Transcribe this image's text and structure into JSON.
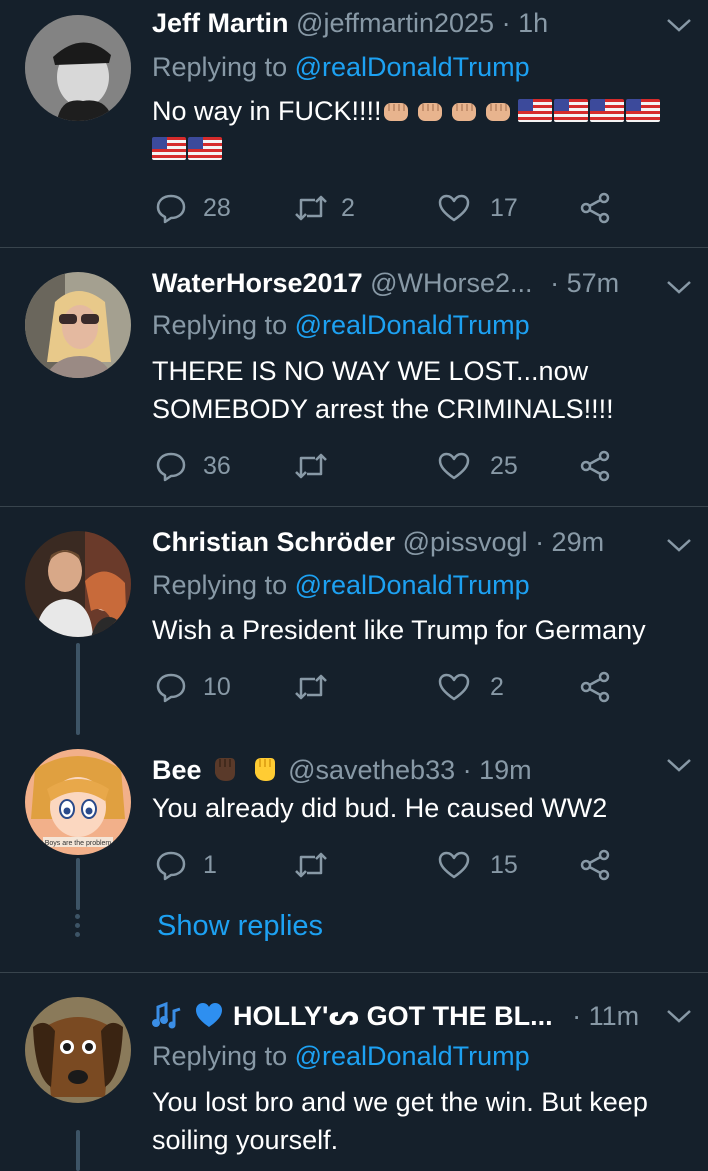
{
  "tweets": [
    {
      "name": "Jeff Martin",
      "handle": "@jeffmartin2025",
      "time": "· 1h",
      "replying_label": "Replying to",
      "replying_to": "@realDonaldTrump",
      "text": "No way in FUCK!!!!",
      "reply_count": "28",
      "retweet_count": "2",
      "like_count": "17"
    },
    {
      "name": "WaterHorse2017",
      "handle": "@WHorse2...",
      "time": "· 57m",
      "replying_label": "Replying to",
      "replying_to": "@realDonaldTrump",
      "text": "THERE IS NO WAY WE LOST...now SOMEBODY arrest the CRIMINALS!!!!",
      "reply_count": "36",
      "retweet_count": "",
      "like_count": "25"
    },
    {
      "name": "Christian Schröder",
      "handle": "@pissvogl",
      "time": "· 29m",
      "replying_label": "Replying to",
      "replying_to": "@realDonaldTrump",
      "text": "Wish a President like Trump for Germany",
      "reply_count": "10",
      "retweet_count": "",
      "like_count": "2"
    },
    {
      "name": "Bee",
      "handle": "@savetheb33",
      "time": "· 19m",
      "text": "You already did bud. He caused WW2",
      "reply_count": "1",
      "retweet_count": "",
      "like_count": "15",
      "avatar_caption": "Boys are the problem"
    },
    {
      "name": "HOLLY'ᔕ GOT THE BL...",
      "handle": "",
      "time": "· 11m",
      "replying_label": "Replying to",
      "replying_to": "@realDonaldTrump",
      "text": "You lost bro and we get the win. But keep soiling yourself."
    }
  ],
  "show_replies": "Show replies",
  "colors": {
    "background": "#15202b",
    "secondary_text": "#8899a6",
    "accent": "#1da1f2",
    "divider": "#38444d"
  }
}
